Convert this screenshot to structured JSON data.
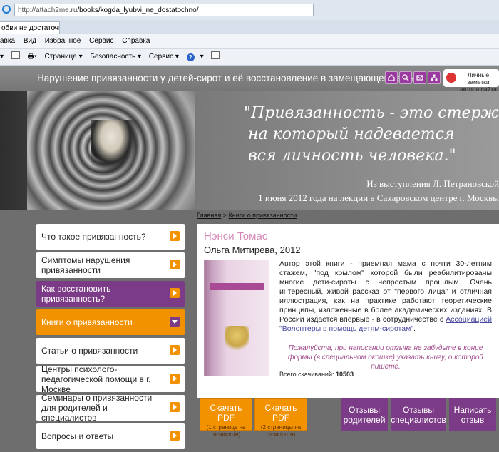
{
  "browser": {
    "url_host": "http://attach2me.ru",
    "url_path": "/books/kogda_lyubvi_ne_dostatochno/",
    "tab_title": "обви не достаточн...",
    "menu": [
      "авка",
      "Вид",
      "Избранное",
      "Сервис",
      "Справка"
    ],
    "commands": [
      "Страница ▾",
      "Безопасность ▾",
      "Сервис ▾"
    ]
  },
  "header": {
    "title": "Нарушение привязанности у детей-сирот и её восстановление в замещающей семье",
    "icons": [
      "home-icon",
      "search-icon",
      "mail-icon",
      "sitemap-icon"
    ],
    "notes_line1": "Личные заметки",
    "notes_line2": "автора сайта"
  },
  "banner": {
    "quote_lines": [
      "\"Привязанность - это стержень,",
      "на который надевается",
      "вся личность человека.\""
    ],
    "credit_line1": "Из выступления Л. Петрановской",
    "credit_line2": "1 июня 2012 года на лекции в Сахаровском центре г. Москвы"
  },
  "breadcrumb": {
    "home": "Главная",
    "separator": ">",
    "current": "Книги о привязанности"
  },
  "sidebar": {
    "items": [
      {
        "label": "Что такое привязанность?",
        "style": "white"
      },
      {
        "label": "Симптомы нарушения привязанности",
        "style": "white"
      },
      {
        "label": "Как восстановить привязанность?",
        "style": "purple"
      },
      {
        "label": "Книги о привязанности",
        "style": "orange"
      },
      {
        "label": "Статьи о привязанности",
        "style": "white"
      },
      {
        "label": "Центры психолого-педагогической помощи в г. Москве",
        "style": "white"
      },
      {
        "label": "Семинары о привязанности для родителей и специалистов",
        "style": "white"
      },
      {
        "label": "Вопросы и ответы",
        "style": "white"
      }
    ]
  },
  "book": {
    "author": "Нэнси Томас",
    "meta": "Ольга Митирева, 2012",
    "desc_before_link": "Автор этой книги - приемная мама с почти 30-летним стажем, \"под крылом\" которой были реабилитированы многие дети-сироты с непростым прошлым. Очень интересный, живой рассказ от \"первого лица\" и отличная иллюстрация, как на практике работают теоретические принципы, изложенные в более академических изданиях. В России издается впервые - в сотрудничестве с ",
    "desc_link": "Ассоциацией \"Волонтеры в помощь детям-сиротам\"",
    "desc_after_link": ".",
    "note": "Пожалуйста, при написании отзыва не забудьте в конце формы (в специальном окошке) указать книгу, о которой пишете.",
    "downloads_label": "Всего скачиваний:",
    "downloads_count": "10503"
  },
  "actions": [
    {
      "label": "Скачать PDF",
      "sub": "(1 страница на развороте)",
      "style": "orange"
    },
    {
      "label": "Скачать PDF",
      "sub": "(2 страницы на развороте)",
      "style": "orange"
    },
    {
      "label": "Отзывы родителей",
      "style": "purple"
    },
    {
      "label": "Отзывы специалистов",
      "style": "purple"
    },
    {
      "label": "Написать отзыв",
      "style": "purple"
    }
  ],
  "colors": {
    "purple": "#7c3b86",
    "orange": "#f39200",
    "pink_author": "#d48ab8",
    "background": "#6e6e6e"
  }
}
